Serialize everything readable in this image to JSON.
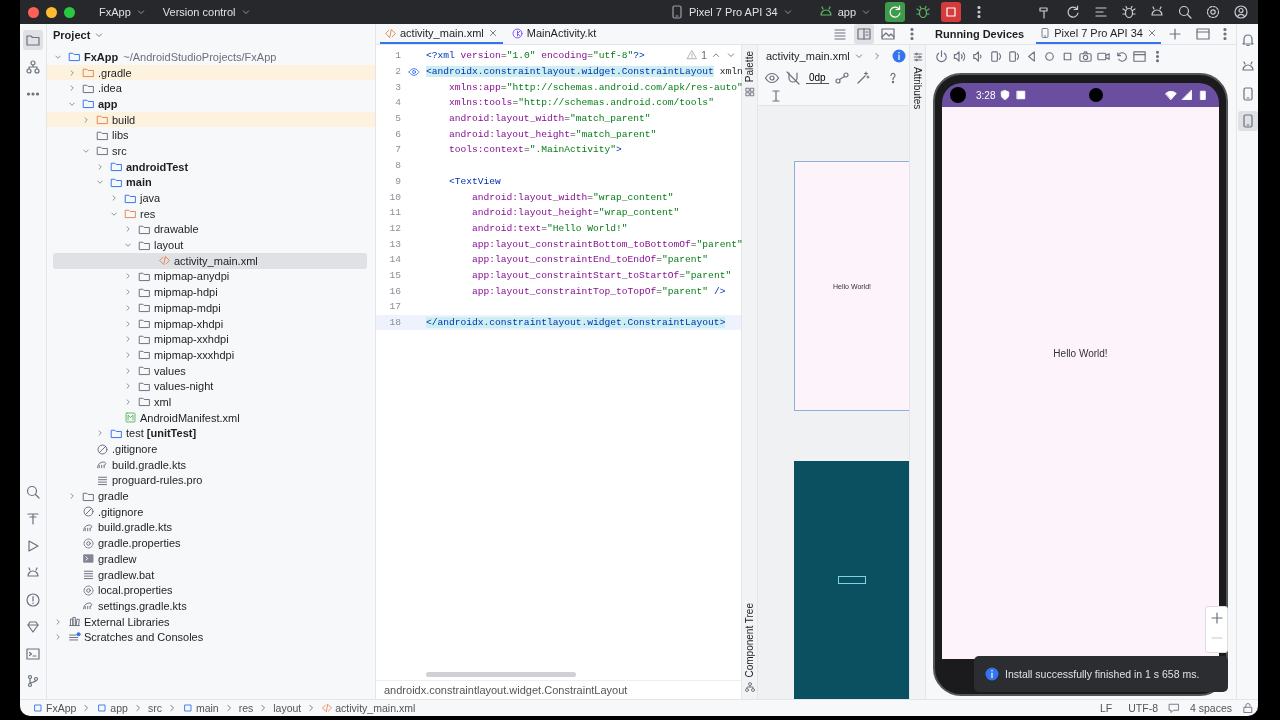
{
  "title_bar": {
    "project": "FxApp",
    "vcs": "Version control",
    "device": "Pixel 7 Pro API 34",
    "run_config": "app"
  },
  "project_panel": {
    "title": "Project",
    "tree": [
      {
        "name": "FxApp",
        "path": "~/AndroidStudioProjects/FxApp",
        "kind": "module",
        "expanded": true,
        "selected": false,
        "children": [
          {
            "name": ".gradle",
            "kind": "folder",
            "ignored": true,
            "expanded": false,
            "selected": false
          },
          {
            "name": ".idea",
            "kind": "folder",
            "expanded": false,
            "selected": false
          },
          {
            "name": "app",
            "kind": "module",
            "expanded": true,
            "selected": false,
            "children": [
              {
                "name": "build",
                "kind": "folder",
                "ignored": true,
                "expanded": false,
                "selected": false
              },
              {
                "name": "libs",
                "kind": "folder",
                "selected": false
              },
              {
                "name": "src",
                "kind": "folder",
                "expanded": true,
                "selected": false,
                "children": [
                  {
                    "name": "androidTest",
                    "kind": "module",
                    "expanded": false,
                    "selected": false
                  },
                  {
                    "name": "main",
                    "kind": "module",
                    "expanded": true,
                    "selected": false,
                    "children": [
                      {
                        "name": "java",
                        "kind": "source",
                        "expanded": false,
                        "selected": false
                      },
                      {
                        "name": "res",
                        "kind": "resources",
                        "expanded": true,
                        "selected": false,
                        "children": [
                          {
                            "name": "drawable",
                            "kind": "folder",
                            "expanded": false,
                            "selected": false
                          },
                          {
                            "name": "layout",
                            "kind": "folder",
                            "expanded": true,
                            "selected": false,
                            "children": [
                              {
                                "name": "activity_main.xml",
                                "kind": "xml",
                                "selected": true
                              }
                            ]
                          },
                          {
                            "name": "mipmap-anydpi",
                            "kind": "folder",
                            "expanded": false,
                            "selected": false
                          },
                          {
                            "name": "mipmap-hdpi",
                            "kind": "folder",
                            "expanded": false,
                            "selected": false
                          },
                          {
                            "name": "mipmap-mdpi",
                            "kind": "folder",
                            "expanded": false,
                            "selected": false
                          },
                          {
                            "name": "mipmap-xhdpi",
                            "kind": "folder",
                            "expanded": false,
                            "selected": false
                          },
                          {
                            "name": "mipmap-xxhdpi",
                            "kind": "folder",
                            "expanded": false,
                            "selected": false
                          },
                          {
                            "name": "mipmap-xxxhdpi",
                            "kind": "folder",
                            "expanded": false,
                            "selected": false
                          },
                          {
                            "name": "values",
                            "kind": "folder",
                            "expanded": false,
                            "selected": false
                          },
                          {
                            "name": "values-night",
                            "kind": "folder",
                            "expanded": false,
                            "selected": false
                          },
                          {
                            "name": "xml",
                            "kind": "folder",
                            "expanded": false,
                            "selected": false
                          }
                        ]
                      },
                      {
                        "name": "AndroidManifest.xml",
                        "kind": "manifest",
                        "selected": false
                      }
                    ]
                  },
                  {
                    "name": "test **[unitTest]**",
                    "kind": "test-module",
                    "expanded": false,
                    "selected": false
                  }
                ]
              },
              {
                "name": ".gitignore",
                "kind": "ignore-file",
                "selected": false
              },
              {
                "name": "build.gradle.kts",
                "kind": "gradle",
                "selected": false
              },
              {
                "name": "proguard-rules.pro",
                "kind": "text",
                "selected": false
              }
            ]
          },
          {
            "name": "gradle",
            "kind": "folder",
            "expanded": false,
            "selected": false
          },
          {
            "name": ".gitignore",
            "kind": "ignore-file",
            "selected": false
          },
          {
            "name": "build.gradle.kts",
            "kind": "gradle",
            "selected": false
          },
          {
            "name": "gradle.properties",
            "kind": "properties",
            "selected": false
          },
          {
            "name": "gradlew",
            "kind": "script",
            "selected": false
          },
          {
            "name": "gradlew.bat",
            "kind": "text",
            "selected": false
          },
          {
            "name": "local.properties",
            "kind": "properties",
            "selected": false
          },
          {
            "name": "settings.gradle.kts",
            "kind": "gradle",
            "selected": false
          }
        ]
      },
      {
        "name": "External Libraries",
        "kind": "libraries",
        "expanded": false,
        "selected": false
      },
      {
        "name": "Scratches and Consoles",
        "kind": "scratches",
        "expanded": false,
        "selected": false
      }
    ]
  },
  "editor": {
    "tabs": [
      {
        "label": "activity_main.xml",
        "kind": "xml",
        "selected": true
      },
      {
        "label": "MainActivity.kt",
        "kind": "kotlin",
        "selected": false
      }
    ],
    "warnings": "1",
    "lines": [
      {
        "number": "1",
        "text": "<?xml version=\"1.0\" encoding=\"utf-8\"?>"
      },
      {
        "number": "2",
        "text": "<androidx.constraintlayout.widget.ConstraintLayout xmln",
        "highlight": true,
        "marker": true
      },
      {
        "number": "3",
        "text": "    xmlns:app=\"http://schemas.android.com/apk/res-auto\""
      },
      {
        "number": "4",
        "text": "    xmlns:tools=\"http://schemas.android.com/tools\""
      },
      {
        "number": "5",
        "text": "    android:layout_width=\"match_parent\""
      },
      {
        "number": "6",
        "text": "    android:layout_height=\"match_parent\""
      },
      {
        "number": "7",
        "text": "    tools:context=\".MainActivity\">"
      },
      {
        "number": "8"
      },
      {
        "number": "9",
        "text": "    <TextView"
      },
      {
        "number": "10",
        "text": "        android:layout_width=\"wrap_content\""
      },
      {
        "number": "11",
        "text": "        android:layout_height=\"wrap_content\""
      },
      {
        "number": "12",
        "text": "        android:text=\"Hello World!\""
      },
      {
        "number": "13",
        "text": "        app:layout_constraintBottom_toBottomOf=\"parent\""
      },
      {
        "number": "14",
        "text": "        app:layout_constraintEnd_toEndOf=\"parent\""
      },
      {
        "number": "15",
        "text": "        app:layout_constraintStart_toStartOf=\"parent\""
      },
      {
        "number": "16",
        "text": "        app:layout_constraintTop_toTopOf=\"parent\" />"
      },
      {
        "number": "17"
      },
      {
        "number": "18",
        "text": "</androidx.constraintlayout.widget.ConstraintLayout>",
        "highlight": true,
        "current": true
      }
    ],
    "breadcrumb": "androidx.constraintlayout.widget.ConstraintLayout"
  },
  "design": {
    "file": "activity_main.xml",
    "margin": "0dp",
    "palette_label": "Palette",
    "attributes_label": "Attributes",
    "component_tree_label": "Component Tree",
    "preview_text": "Hello World!"
  },
  "running_devices": {
    "title": "Running Devices",
    "tabs": [
      {
        "label": "Pixel 7 Pro API 34",
        "selected": true
      }
    ],
    "time": "3:28",
    "screen_text": "Hello World!"
  },
  "notification": {
    "message": "Install successfully finished in 1 s 658 ms."
  },
  "status_bar": {
    "breadcrumbs": [
      {
        "label": "FxApp",
        "kind": "module"
      },
      {
        "label": "app",
        "kind": "module"
      },
      {
        "label": "src",
        "kind": "folder"
      },
      {
        "label": "main",
        "kind": "module"
      },
      {
        "label": "res",
        "kind": "folder"
      },
      {
        "label": "layout",
        "kind": "folder"
      },
      {
        "label": "activity_main.xml",
        "kind": "xml"
      }
    ],
    "line_separator": "LF",
    "encoding": "UTF-8",
    "indent": "4 spaces"
  }
}
